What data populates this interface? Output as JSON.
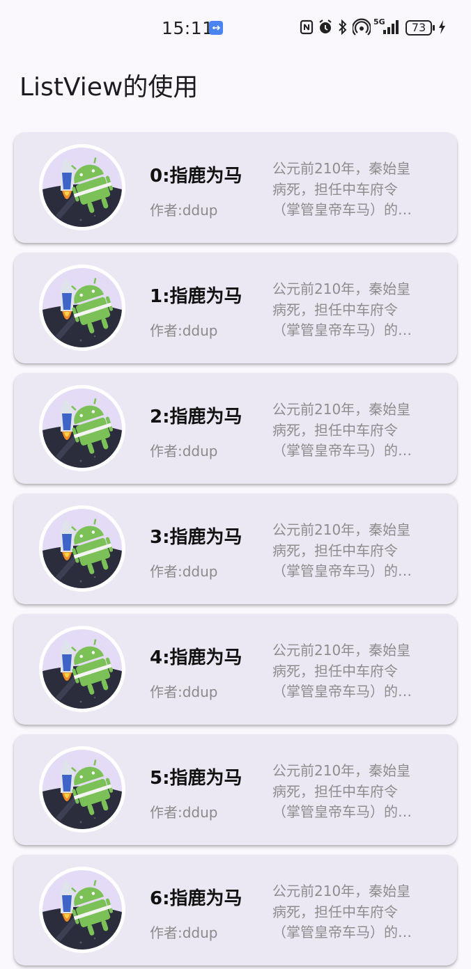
{
  "status_bar": {
    "time": "15:11",
    "network": "5G",
    "battery": "73",
    "icons": [
      "usb-icon",
      "nfc-icon",
      "alarm-icon",
      "bluetooth-icon",
      "hotspot-icon",
      "signal-icon",
      "battery-icon",
      "charging-icon"
    ]
  },
  "app": {
    "title": "ListView的使用"
  },
  "list": {
    "items": [
      {
        "title": "0:指鹿为马",
        "author": "作者:ddup",
        "desc": "公元前210年，秦始皇\n病死，担任中车府令\n（掌管皇帝车马）的…"
      },
      {
        "title": "1:指鹿为马",
        "author": "作者:ddup",
        "desc": "公元前210年，秦始皇\n病死，担任中车府令\n（掌管皇帝车马）的…"
      },
      {
        "title": "2:指鹿为马",
        "author": "作者:ddup",
        "desc": "公元前210年，秦始皇\n病死，担任中车府令\n（掌管皇帝车马）的…"
      },
      {
        "title": "3:指鹿为马",
        "author": "作者:ddup",
        "desc": "公元前210年，秦始皇\n病死，担任中车府令\n（掌管皇帝车马）的…"
      },
      {
        "title": "4:指鹿为马",
        "author": "作者:ddup",
        "desc": "公元前210年，秦始皇\n病死，担任中车府令\n（掌管皇帝车马）的…"
      },
      {
        "title": "5:指鹿为马",
        "author": "作者:ddup",
        "desc": "公元前210年，秦始皇\n病死，担任中车府令\n（掌管皇帝车马）的…"
      },
      {
        "title": "6:指鹿为马",
        "author": "作者:ddup",
        "desc": "公元前210年，秦始皇\n病死，担任中车府令\n（掌管皇帝车马）的…"
      }
    ]
  }
}
